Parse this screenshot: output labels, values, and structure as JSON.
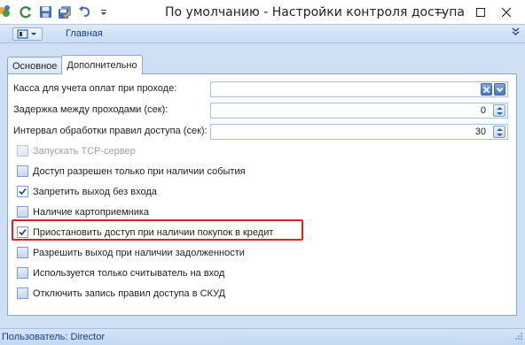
{
  "window": {
    "title": "По умолчанию - Настройки контроля доступа",
    "controls": {
      "minimize": "—",
      "maximize": "☐",
      "close": "✕"
    }
  },
  "quick_access": [
    "app-icon",
    "refresh-icon",
    "save-icon",
    "save-all-icon",
    "undo-icon",
    "dropdown-icon"
  ],
  "ribbon": {
    "tab_label": "Главная"
  },
  "tabs": [
    {
      "label": "Основное",
      "active": false
    },
    {
      "label": "Дополнительно",
      "active": true
    }
  ],
  "fields": [
    {
      "label": "Касса для учета оплат при проходе:",
      "value": "",
      "kind": "combo"
    },
    {
      "label": "Задержка между проходами (сек):",
      "value": "0",
      "kind": "spin"
    },
    {
      "label": "Интервал обработки правил доступа (сек):",
      "value": "30",
      "kind": "spin"
    }
  ],
  "checkboxes": [
    {
      "label": "Запускать TCP-сервер",
      "checked": false,
      "disabled": true
    },
    {
      "label": "Доступ разрешен только при наличии события",
      "checked": false,
      "disabled": false
    },
    {
      "label": "Запретить выход без входа",
      "checked": true,
      "disabled": false
    },
    {
      "label": "Наличие картоприемника",
      "checked": false,
      "disabled": false
    },
    {
      "label": "Приостановить доступ при наличии покупок в кредит",
      "checked": true,
      "disabled": false
    },
    {
      "label": "Разрешить выход при наличии задолженности",
      "checked": false,
      "disabled": false
    },
    {
      "label": "Используется только считыватель на вход",
      "checked": false,
      "disabled": false
    },
    {
      "label": "Отключить запись правил доступа в СКУД",
      "checked": false,
      "disabled": false
    }
  ],
  "status": {
    "text": "Пользователь: Director"
  },
  "colors": {
    "accent": "#15428b",
    "highlight": "#e02020",
    "panel_bg": "#cfe0f5"
  }
}
